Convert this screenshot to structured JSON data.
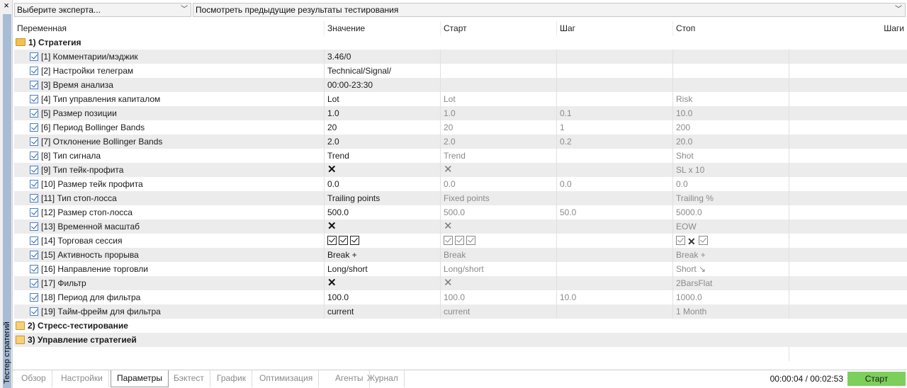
{
  "side_panel": {
    "title": "Тестер стратегий",
    "close": "×"
  },
  "top": {
    "expert_select": "Выберите эксперта...",
    "history_select": "Посмотреть предыдущие результаты тестирования"
  },
  "table": {
    "headers": {
      "variable": "Переменная",
      "value": "Значение",
      "start": "Старт",
      "step": "Шаг",
      "stop": "Стоп",
      "steps": "Шаги"
    },
    "group1": "1) Стратегия",
    "rows": [
      {
        "name": "[1] Комментарии/мэджик",
        "value": "3.46/0",
        "start": "",
        "step": "",
        "stop": ""
      },
      {
        "name": "[2] Настройки телеграм",
        "value": "Technical/Signal/",
        "start": "",
        "step": "",
        "stop": ""
      },
      {
        "name": "[3] Время анализа",
        "value": "00:00-23:30",
        "start": "",
        "step": "",
        "stop": ""
      },
      {
        "name": "[4] Тип управления капиталом",
        "value": "Lot",
        "start": "Lot",
        "step": "",
        "stop": "Risk"
      },
      {
        "name": "[5] Размер позиции",
        "value": "1.0",
        "start": "1.0",
        "step": "0.1",
        "stop": "10.0"
      },
      {
        "name": "[6] Период Bollinger Bands",
        "value": "20",
        "start": "20",
        "step": "1",
        "stop": "200"
      },
      {
        "name": "[7] Отклонение Bollinger Bands",
        "value": "2.0",
        "start": "2.0",
        "step": "0.2",
        "stop": "20.0"
      },
      {
        "name": "[8] Тип сигнала",
        "value": "Trend",
        "start": "Trend",
        "step": "",
        "stop": "Shot"
      },
      {
        "name": "[9] Тип тейк-профита",
        "value": "✕",
        "start": "✕",
        "step": "",
        "stop": "SL x 10"
      },
      {
        "name": "[10] Размер тейк профита",
        "value": "0.0",
        "start": "0.0",
        "step": "0.0",
        "stop": "0.0"
      },
      {
        "name": "[11] Тип стоп-лосса",
        "value": "Trailing points",
        "start": "Fixed points",
        "step": "",
        "stop": "Trailing %"
      },
      {
        "name": "[12] Размер стоп-лосса",
        "value": "500.0",
        "start": "500.0",
        "step": "50.0",
        "stop": "5000.0"
      },
      {
        "name": "[13] Временной масштаб",
        "value": "✕",
        "start": "✕",
        "step": "",
        "stop": "EOW"
      },
      {
        "name": "[14] Торговая сессия",
        "value": "",
        "start": "",
        "step": "",
        "stop": ""
      },
      {
        "name": "[15] Активность прорыва",
        "value": "Break +",
        "start": "Break",
        "step": "",
        "stop": "Break +"
      },
      {
        "name": "[16] Направление торговли",
        "value": "Long/short",
        "start": "Long/short",
        "step": "",
        "stop": "Short ↘"
      },
      {
        "name": "[17] Фильтр",
        "value": "✕",
        "start": "✕",
        "step": "",
        "stop": "2BarsFlat"
      },
      {
        "name": "[18] Период для фильтра",
        "value": "100.0",
        "start": "100.0",
        "step": "10.0",
        "stop": "1000.0"
      },
      {
        "name": "[19] Тайм-фрейм для фильтра",
        "value": "current",
        "start": "current",
        "step": "",
        "stop": "1 Month"
      }
    ],
    "group2": "2) Стресс-тестирование",
    "group3": "3) Управление стратегией"
  },
  "tabs": [
    "Обзор",
    "Настройки",
    "Параметры",
    "Бэктест",
    "График",
    "Оптимизация",
    "Агенты",
    "Журнал"
  ],
  "active_tab": "Параметры",
  "timer": "00:00:04 / 00:02:53",
  "start_button": "Старт",
  "colors": {
    "start_button": "#7ccf5a",
    "side_accent": "#a8bcd6",
    "alt_row": "#ececec"
  }
}
